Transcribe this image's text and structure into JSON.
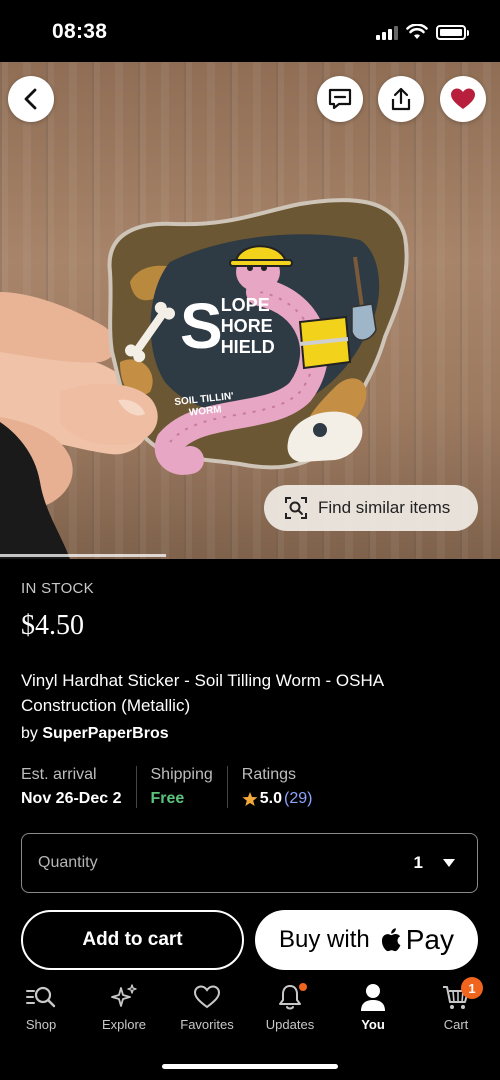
{
  "status_bar": {
    "time": "08:38"
  },
  "hero": {
    "find_similar_label": "Find similar items",
    "sticker": {
      "slope": "LOPE",
      "shore": "HORE",
      "shield": "HIELD",
      "big_letter": "S",
      "subtitle_line1": "SOIL TILLIN'",
      "subtitle_line2": "WORM"
    }
  },
  "product": {
    "stock_status": "IN STOCK",
    "price": "$4.50",
    "title": "Vinyl Hardhat Sticker - Soil Tilling Worm - OSHA Construction (Metallic)",
    "seller_prefix": "by ",
    "seller_name": "SuperPaperBros",
    "arrival_label": "Est. arrival",
    "arrival_value": "Nov 26-Dec 2",
    "shipping_label": "Shipping",
    "shipping_value": "Free",
    "ratings_label": "Ratings",
    "rating_value": "5.0",
    "rating_count": "(29)",
    "quantity_label": "Quantity",
    "quantity_value": "1",
    "add_to_cart_label": "Add to cart",
    "buy_with_label": "Buy with",
    "pay_label": "Pay"
  },
  "tabs": [
    {
      "label": "Shop",
      "icon": "search-icon"
    },
    {
      "label": "Explore",
      "icon": "sparkle-icon"
    },
    {
      "label": "Favorites",
      "icon": "heart-icon"
    },
    {
      "label": "Updates",
      "icon": "bell-icon"
    },
    {
      "label": "You",
      "icon": "person-icon"
    },
    {
      "label": "Cart",
      "icon": "cart-icon"
    }
  ],
  "cart_badge": "1",
  "colors": {
    "accent": "#f1641e",
    "favorite": "#b81f3c",
    "free": "#5cc47a",
    "rating_count": "#8ea3ff"
  }
}
